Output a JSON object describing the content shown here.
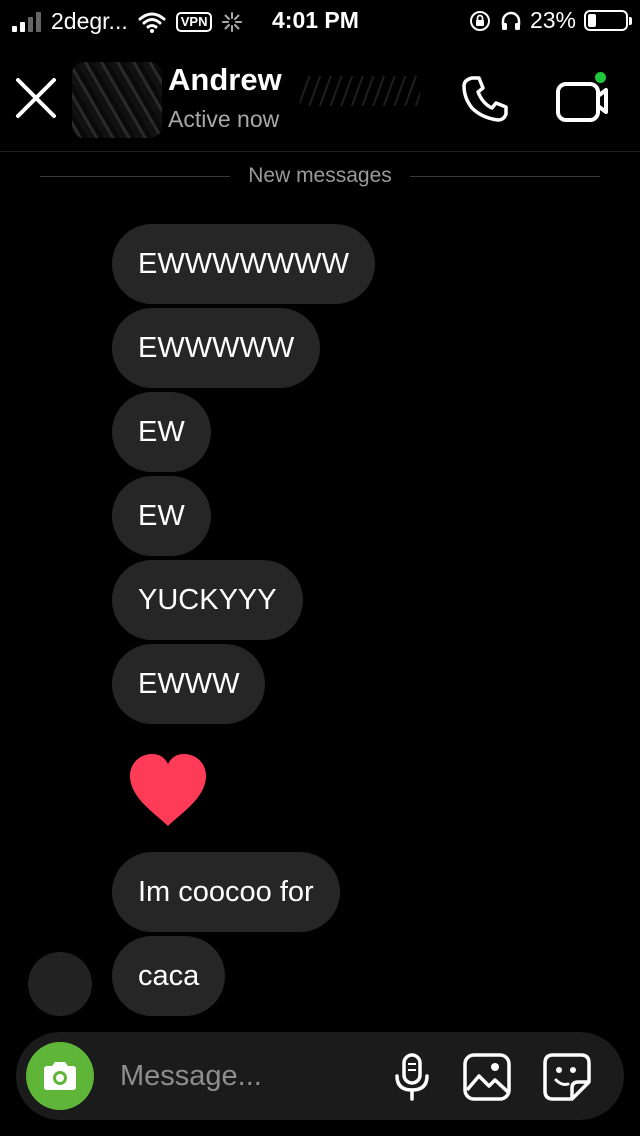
{
  "status_bar": {
    "carrier": "2degr...",
    "vpn": "VPN",
    "time": "4:01 PM",
    "battery": "23%",
    "battery_level": 0.23
  },
  "header": {
    "contact_name": "Andrew",
    "contact_status": "Active now",
    "icons": [
      "close-icon",
      "phone-icon",
      "video-call-icon"
    ],
    "video_dot_color": "#1ec83a"
  },
  "divider": {
    "label": "New messages"
  },
  "messages": [
    {
      "text": "EWWWWWWW"
    },
    {
      "text": "EWWWWW"
    },
    {
      "text": "EW"
    },
    {
      "text": "EW"
    },
    {
      "text": "YUCKYYY"
    },
    {
      "text": "EWWW"
    },
    {
      "reaction": "heart-icon"
    },
    {
      "text": "Im coocoo for"
    },
    {
      "text": "caca"
    }
  ],
  "composer": {
    "placeholder": "Message...",
    "icons": [
      "camera-icon",
      "microphone-icon",
      "gallery-icon",
      "sticker-icon"
    ]
  },
  "colors": {
    "background": "#000000",
    "bubble": "#262626",
    "heart": "#ff3b57",
    "camera_button": "#5fb538"
  }
}
